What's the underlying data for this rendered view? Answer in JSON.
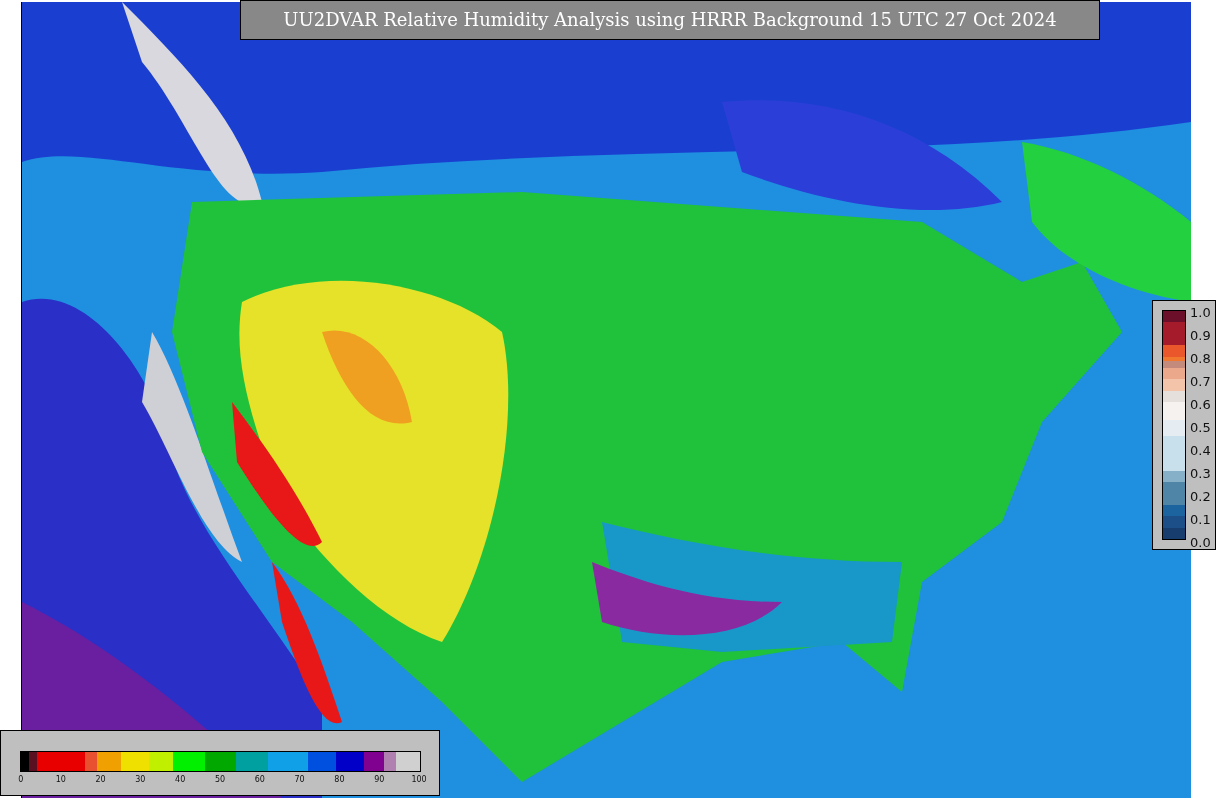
{
  "title": "UU2DVAR Relative Humidity Analysis using HRRR Background 15 UTC 27 Oct 2024",
  "station_legend": {
    "ticks": [
      "1.0",
      "0.9",
      "0.8",
      "0.7",
      "0.6",
      "0.5",
      "0.4",
      "0.3",
      "0.2",
      "0.1",
      "0.0"
    ]
  },
  "humidity_legend": {
    "ticks": [
      "0",
      "10",
      "20",
      "30",
      "40",
      "50",
      "60",
      "70",
      "80",
      "90",
      "100"
    ]
  }
}
